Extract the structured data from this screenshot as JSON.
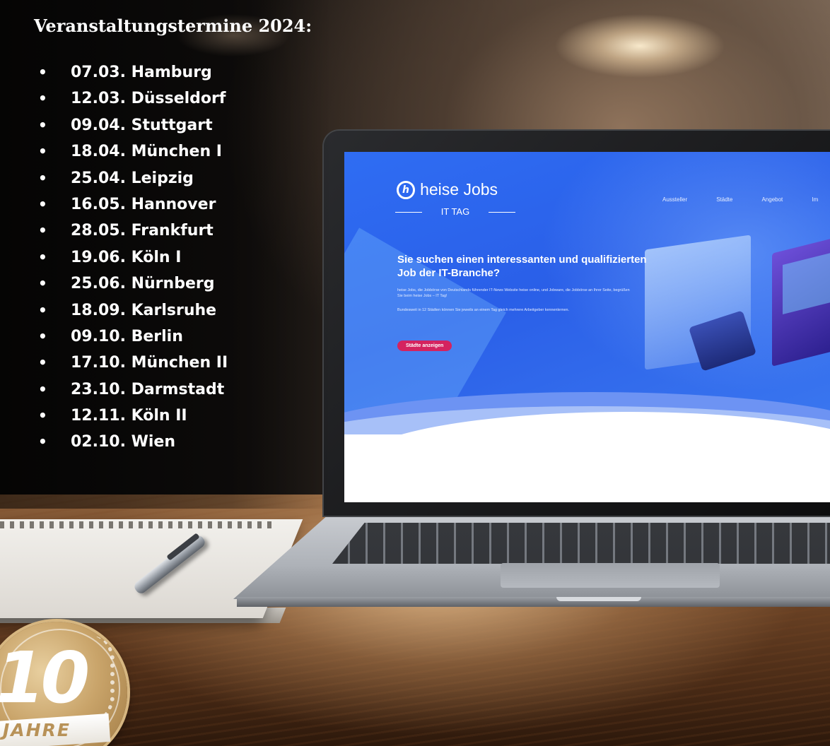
{
  "events": {
    "title": "Veranstaltungstermine 2024:",
    "items": [
      "07.03. Hamburg",
      "12.03. Düsseldorf",
      "09.04. Stuttgart",
      "18.04. München I",
      "25.04. Leipzig",
      "16.05. Hannover",
      "28.05. Frankfurt",
      "19.06. Köln I",
      "25.06. Nürnberg",
      "18.09. Karlsruhe",
      "09.10. Berlin",
      "17.10. München II",
      "23.10. Darmstadt",
      "12.11. Köln II",
      "02.10. Wien"
    ]
  },
  "website": {
    "logo_mark": "h",
    "logo_text": "heise Jobs",
    "logo_sub": "IT TAG",
    "nav": [
      "Aussteller",
      "Städte",
      "Angebot",
      "Im"
    ],
    "headline": "Sie suchen einen interessanten und qualifizierten Job der IT-Branche?",
    "paragraph_1": "heise Jobs, die Jobbörse von Deutschlands führender IT-News Website heise online, und Jobware, die Jobbörse an Ihrer Seite, begrüßen Sie beim heise Jobs – IT Tag!",
    "paragraph_2": "Bundesweit in 12 Städten können Sie jeweils an einem Tag gleich mehrere Arbeitgeber kennenlernen.",
    "cta_label": "Städte anzeigen",
    "colors": {
      "hero": "#2f6df3",
      "cta": "#d4235f"
    }
  },
  "badge": {
    "number": "10",
    "word": "JAHRE",
    "colors": {
      "gold": "#c9a46a"
    }
  }
}
